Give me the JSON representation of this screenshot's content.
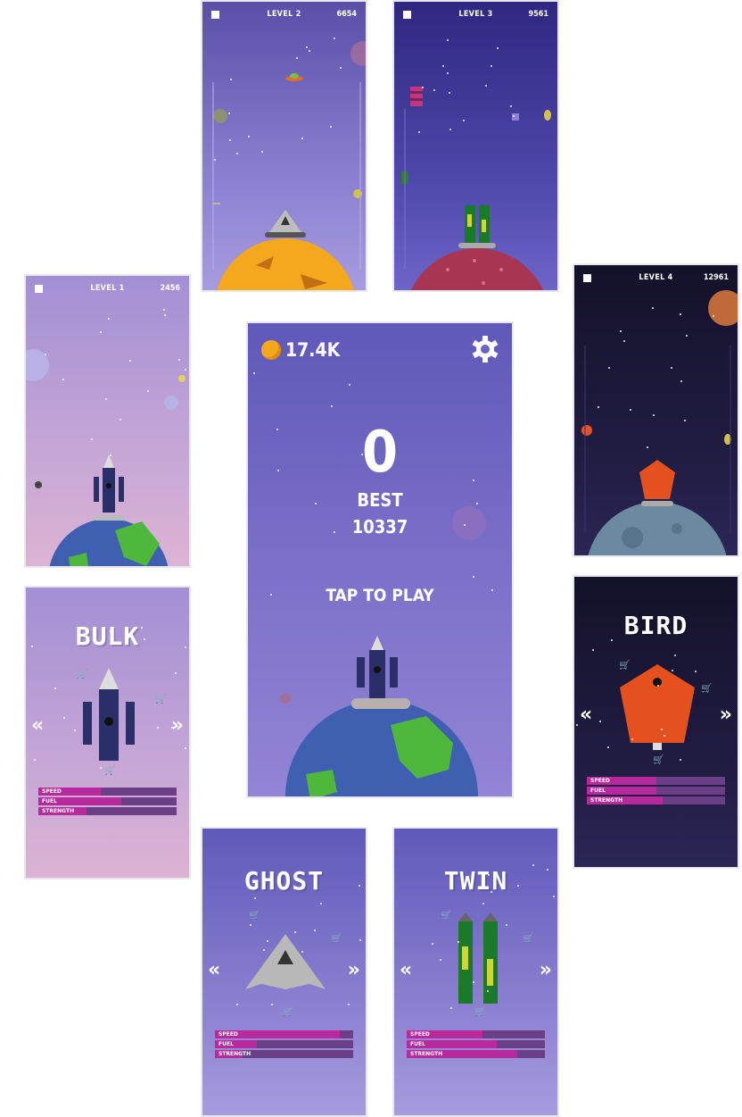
{
  "levels": [
    {
      "label": "LEVEL 1",
      "score": "2456"
    },
    {
      "label": "LEVEL 2",
      "score": "6654"
    },
    {
      "label": "LEVEL 3",
      "score": "9561"
    },
    {
      "label": "LEVEL 4",
      "score": "12961"
    }
  ],
  "main": {
    "coins": "17.4K",
    "current_score": "0",
    "best_label": "BEST",
    "best_score": "10337",
    "tap_to_play": "TAP TO PLAY"
  },
  "ships": [
    {
      "name": "BULK",
      "speed": 0.45,
      "fuel": 0.6,
      "strength": 0.35
    },
    {
      "name": "BIRD",
      "speed": 0.5,
      "fuel": 0.5,
      "strength": 0.55
    },
    {
      "name": "GHOST",
      "speed": 0.9,
      "fuel": 0.3,
      "strength": 0.2
    },
    {
      "name": "TWIN",
      "speed": 0.55,
      "fuel": 0.65,
      "strength": 0.8
    }
  ],
  "stat_labels": {
    "speed": "SPEED",
    "fuel": "FUEL",
    "strength": "STRENGTH"
  },
  "arrows": {
    "left": "«",
    "right": "»"
  },
  "colors": {
    "bar_fill": "#b8299e",
    "bar_bg": "#6a3f86",
    "coin": "#f6a81c"
  }
}
